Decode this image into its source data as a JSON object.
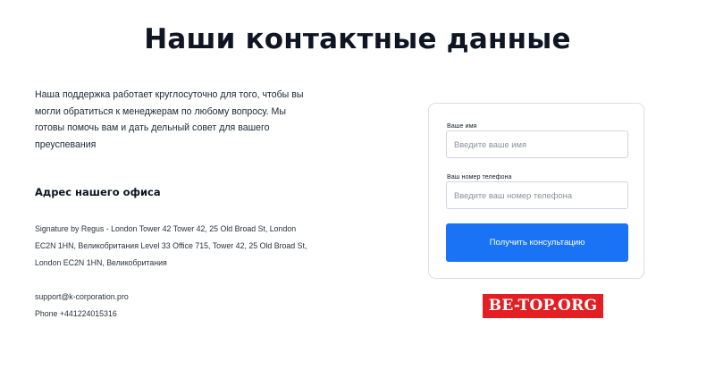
{
  "page": {
    "title": "Наши контактные данные"
  },
  "intro": {
    "text": "Наша поддержка работает круглосуточно для того, чтобы вы могли обратиться к менеджерам по любому вопросу. Мы готовы помочь вам и дать дельный совет для вашего преуспевания"
  },
  "office": {
    "heading": "Адрес нашего офиса",
    "address": "Signature by Regus - London Tower 42 Tower 42, 25 Old Broad St, London EC2N 1HN, Великобритания Level 33 Office 715, Tower 42, 25 Old Broad St, London EC2N 1HN, Великобритания",
    "email": "support@k-corporation.pro",
    "phone": "Phone +441224015316"
  },
  "form": {
    "name_label": "Ваше имя",
    "name_placeholder": "Введите ваше имя",
    "name_value": "",
    "phone_label": "Ваш номер телефона",
    "phone_placeholder": "Введите ваш номер телефона",
    "phone_value": "",
    "submit_label": "Получить консультацию"
  },
  "watermark": {
    "text": "BE-TOP.ORG"
  },
  "colors": {
    "accent": "#1a73f5",
    "heading": "#0f1523",
    "watermark_bg": "#e41f24"
  }
}
